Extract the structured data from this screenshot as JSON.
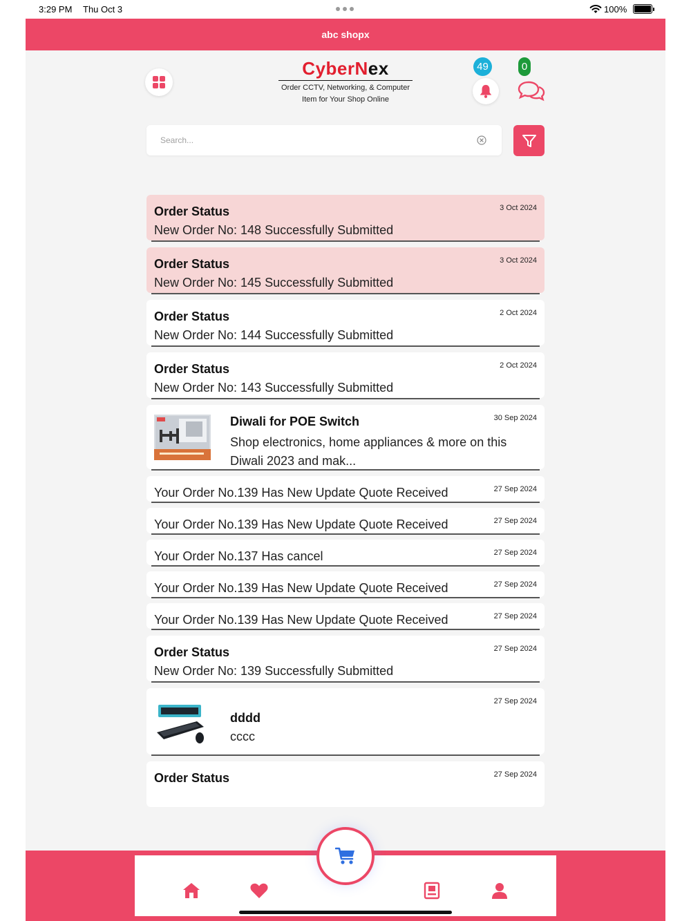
{
  "status_bar": {
    "time": "3:29 PM",
    "date": "Thu Oct 3",
    "battery": "100%"
  },
  "app": {
    "title": "abc shopx",
    "logo": {
      "name_part1": "Cyber",
      "name_part2": "N",
      "name_part3": "ex",
      "tagline_line1": "Order CCTV, Networking, & Computer",
      "tagline_line2": "Item for Your Shop Online"
    },
    "notifications_count": "49",
    "messages_count": "0"
  },
  "search": {
    "placeholder": "Search..."
  },
  "notifications": [
    {
      "kind": "titled",
      "unread": true,
      "title": "Order Status",
      "body": "New Order No: 148 Successfully Submitted",
      "date": "3 Oct 2024"
    },
    {
      "kind": "titled",
      "unread": true,
      "title": "Order Status",
      "body": "New Order No: 145 Successfully Submitted",
      "date": "3 Oct 2024"
    },
    {
      "kind": "titled",
      "unread": false,
      "title": "Order Status",
      "body": "New Order No: 144 Successfully Submitted",
      "date": "2 Oct 2024"
    },
    {
      "kind": "titled",
      "unread": false,
      "title": "Order Status",
      "body": "New Order No: 143 Successfully Submitted",
      "date": "2 Oct 2024"
    },
    {
      "kind": "image",
      "unread": false,
      "title": "Diwali for POE Switch",
      "body": "Shop electronics, home appliances & more on this Diwali 2023 and mak...",
      "date": "30 Sep 2024",
      "image": "tv-wall-mount"
    },
    {
      "kind": "single",
      "unread": false,
      "body": "Your Order No.139 Has New Update Quote Received",
      "date": "27 Sep 2024"
    },
    {
      "kind": "single",
      "unread": false,
      "body": "Your Order No.139 Has New Update Quote Received",
      "date": "27 Sep 2024"
    },
    {
      "kind": "single",
      "unread": false,
      "body": "Your Order No.137 Has cancel",
      "date": "27 Sep 2024"
    },
    {
      "kind": "single",
      "unread": false,
      "body": "Your Order No.139 Has New Update Quote Received",
      "date": "27 Sep 2024"
    },
    {
      "kind": "single",
      "unread": false,
      "body": "Your Order No.139 Has New Update Quote Received",
      "date": "27 Sep 2024"
    },
    {
      "kind": "titled",
      "unread": false,
      "title": "Order Status",
      "body": "New Order No: 139 Successfully Submitted",
      "date": "27 Sep 2024"
    },
    {
      "kind": "image",
      "unread": false,
      "title": "dddd",
      "body": "cccc",
      "date": "27 Sep 2024",
      "image": "keyboard-mouse"
    },
    {
      "kind": "titled",
      "unread": false,
      "title": "Order Status",
      "body": "",
      "date": "27 Sep 2024"
    }
  ],
  "bottom_nav": [
    "home-icon",
    "heart-icon",
    "cart-icon",
    "orders-icon",
    "profile-icon"
  ],
  "colors": {
    "accent": "#ec4766",
    "unread_bg": "#f7d6d6",
    "bell_badge": "#1cb0d9",
    "chat_badge": "#1d9a3a",
    "cart_icon": "#2f6fe0"
  }
}
